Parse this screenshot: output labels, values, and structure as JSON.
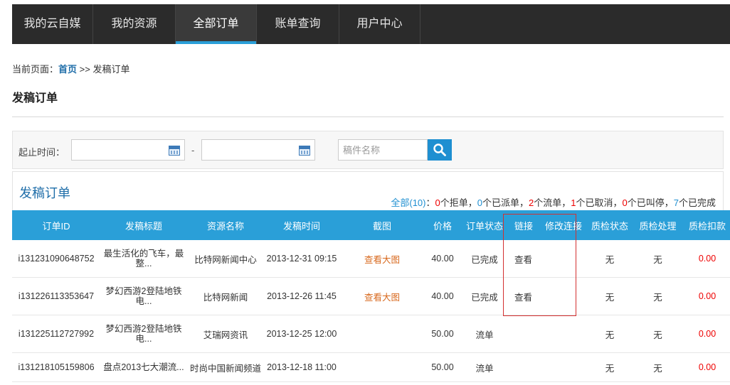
{
  "nav": [
    {
      "label": "我的云自媒"
    },
    {
      "label": "我的资源"
    },
    {
      "label": "全部订单",
      "active": true
    },
    {
      "label": "账单查询"
    },
    {
      "label": "用户中心"
    }
  ],
  "breadcrumb": {
    "prefix": "当前页面：",
    "home": "首页",
    "sep": " >> ",
    "current": "发稿订单"
  },
  "page_title": "发稿订单",
  "filter": {
    "date_label": "起止时间：",
    "dash": "-",
    "search_placeholder": "稿件名称"
  },
  "panel": {
    "title": "发稿订单",
    "summary": {
      "all": "全部(10)",
      "rejected": "0",
      "rejected_label": "个拒单，",
      "dispatched": "0",
      "dispatched_label": "个已派单，",
      "failed": "2",
      "failed_label": "个流单，",
      "cancelled": "1",
      "cancelled_label": "个已取消，",
      "paused": "0",
      "paused_label": "个已叫停，",
      "done": "7",
      "done_label": "个已完成"
    }
  },
  "table": {
    "headers": [
      "订单ID",
      "发稿标题",
      "资源名称",
      "发稿时间",
      "截图",
      "价格",
      "订单状态",
      "链接",
      "修改连接",
      "质检状态",
      "质检处理",
      "质检扣款"
    ],
    "rows": [
      {
        "id": "i131231090648752",
        "title": "最生活化的飞车，最整...",
        "resource": "比特网新闻中心",
        "time": "2013-12-31 09:15",
        "shot": "查看大图",
        "price": "40.00",
        "status": "已完成",
        "link": "查看",
        "modify": "",
        "qc_status": "无",
        "qc_handle": "无",
        "deduct": "0.00"
      },
      {
        "id": "i131226113353647",
        "title": "梦幻西游2登陆地铁电...",
        "resource": "比特网新闻",
        "time": "2013-12-26 11:45",
        "shot": "查看大图",
        "price": "40.00",
        "status": "已完成",
        "link": "查看",
        "modify": "",
        "qc_status": "无",
        "qc_handle": "无",
        "deduct": "0.00"
      },
      {
        "id": "i131225112727992",
        "title": "梦幻西游2登陆地铁电...",
        "resource": "艾瑞网资讯",
        "time": "2013-12-25 12:00",
        "shot": "",
        "price": "50.00",
        "status": "流单",
        "link": "",
        "modify": "",
        "qc_status": "无",
        "qc_handle": "无",
        "deduct": "0.00"
      },
      {
        "id": "i131218105159806",
        "title": "盘点2013七大潮流...",
        "resource": "时尚中国新闻频道",
        "time": "2013-12-18 11:00",
        "shot": "",
        "price": "50.00",
        "status": "流单",
        "link": "",
        "modify": "",
        "qc_status": "无",
        "qc_handle": "无",
        "deduct": "0.00"
      }
    ]
  },
  "colors": {
    "accent": "#2a9fd8",
    "nav_bg": "#2b2b2b",
    "link": "#1f6ea9",
    "screenshot_link": "#d8691e",
    "deduct": "#ee0000",
    "highlight_box": "#d43030"
  }
}
